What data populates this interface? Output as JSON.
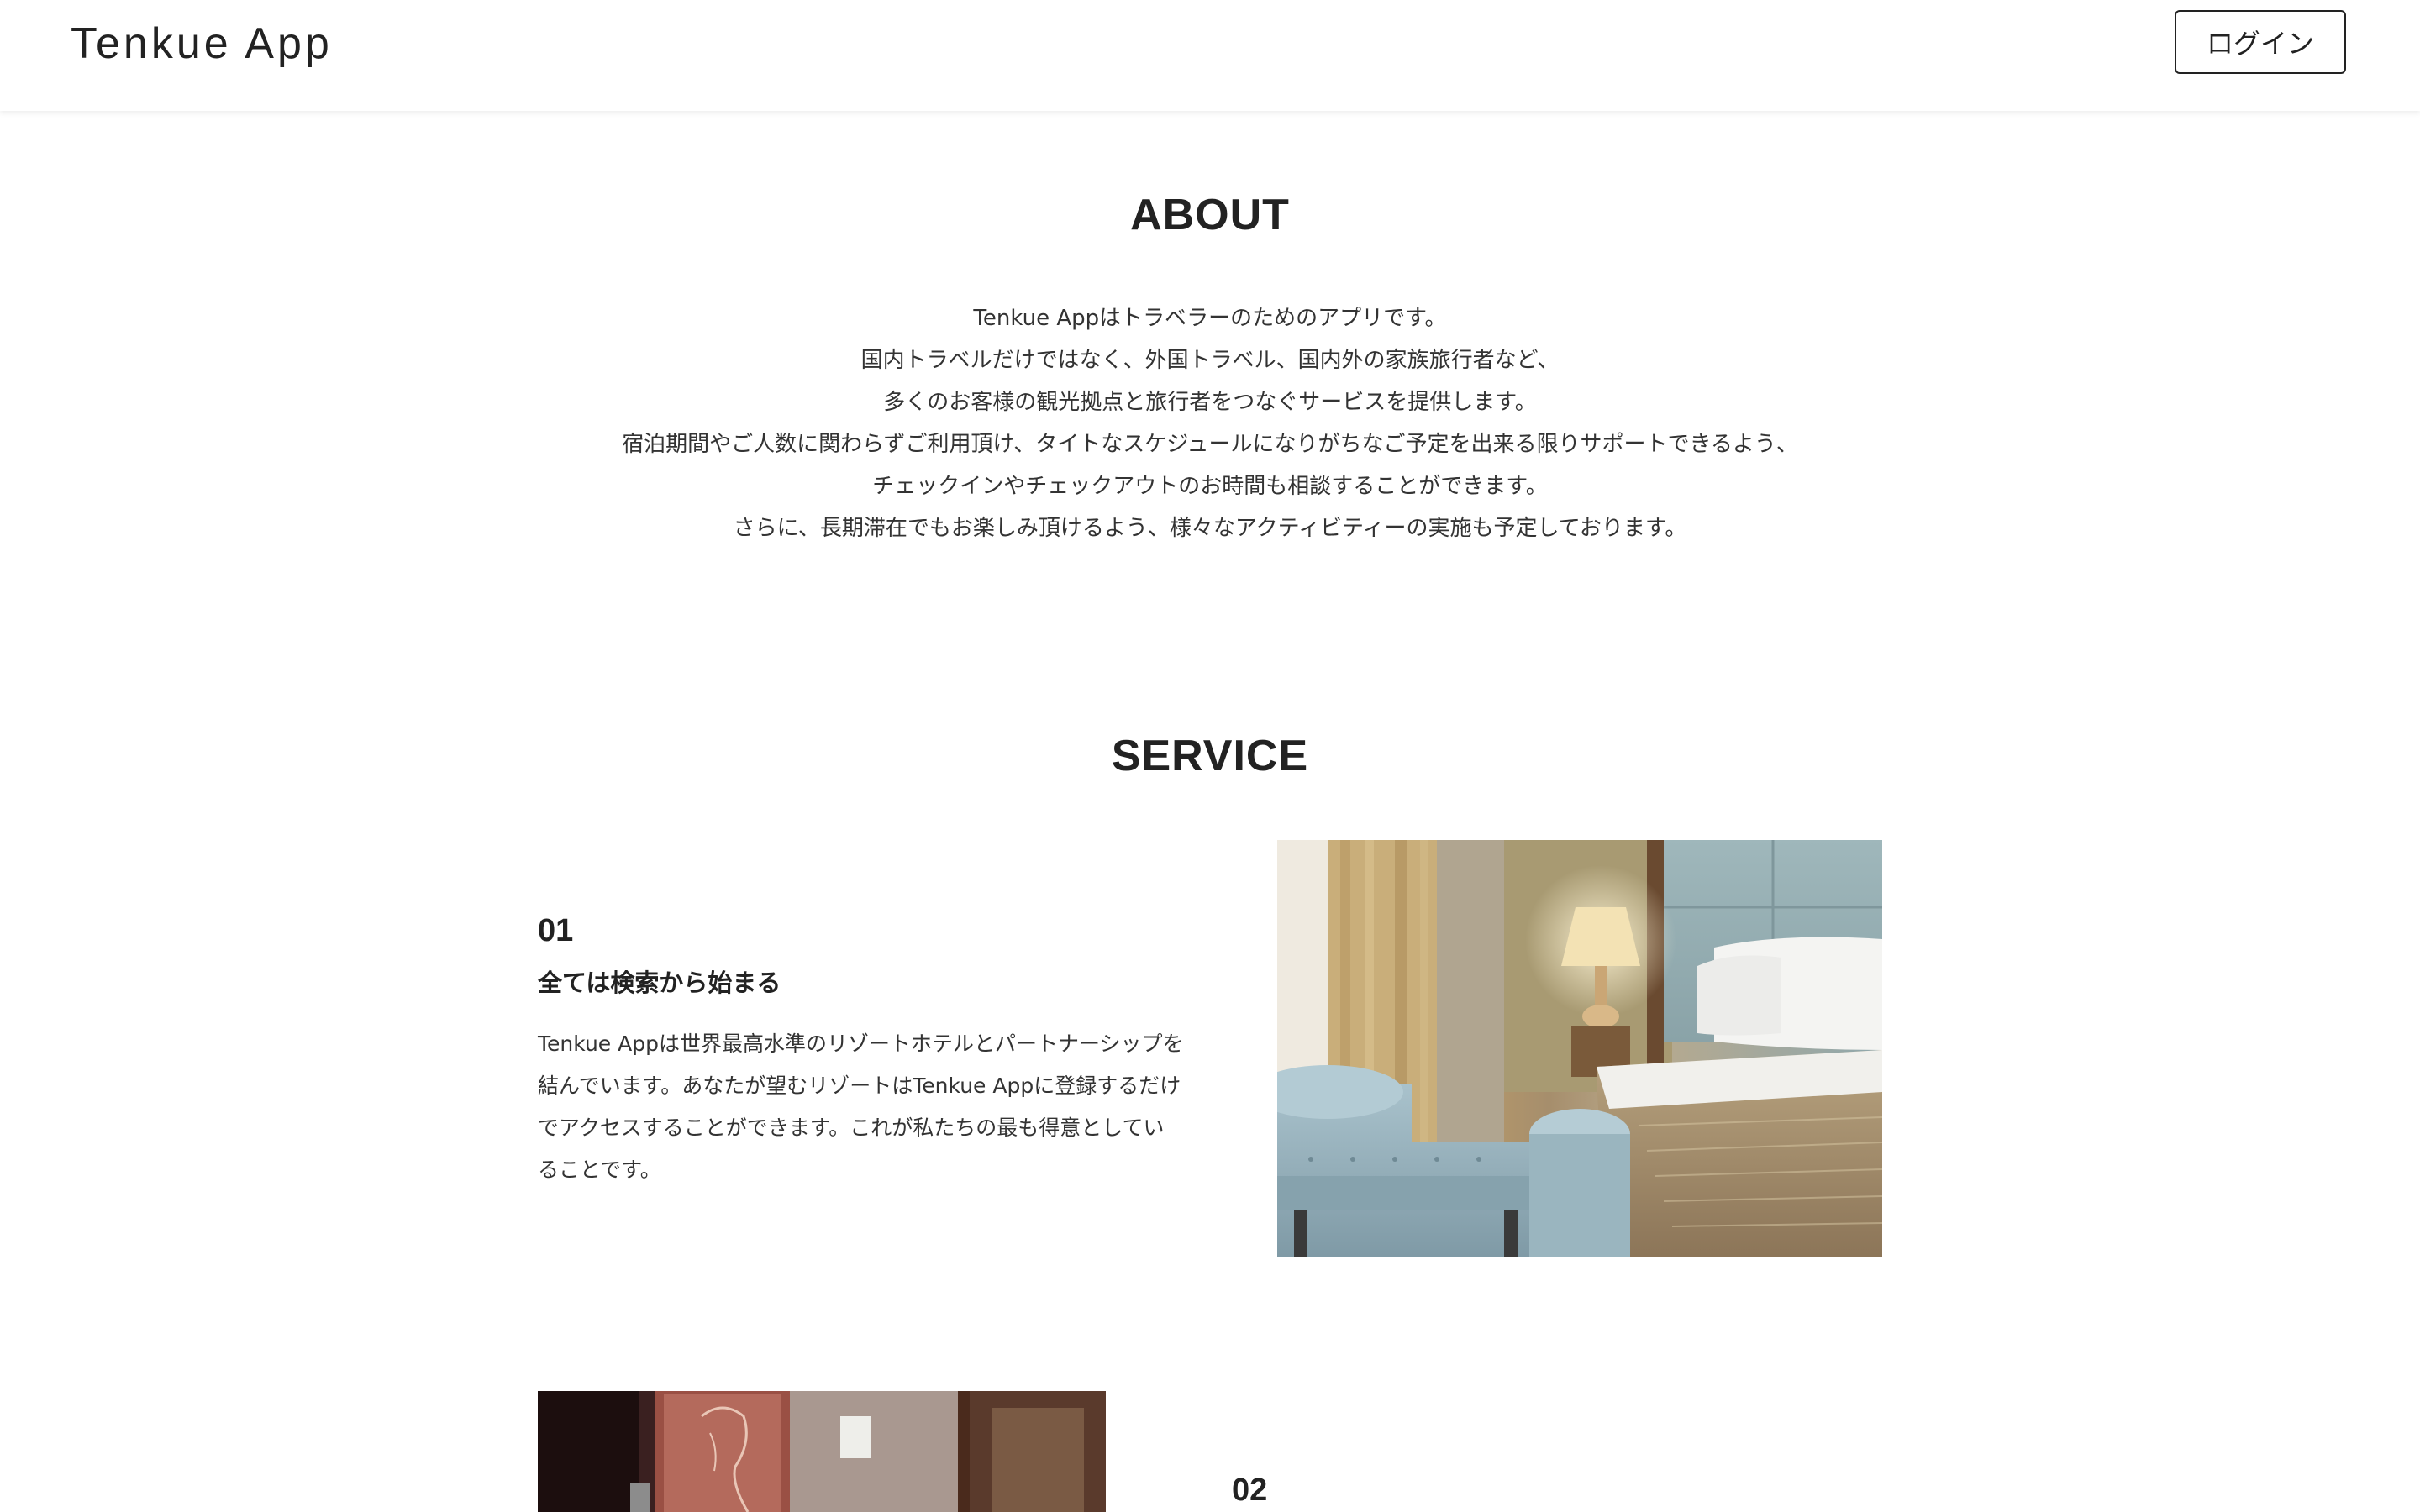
{
  "header": {
    "app_title": "Tenkue App",
    "login_label": "ログイン"
  },
  "about": {
    "title": "ABOUT",
    "lines": [
      "Tenkue Appはトラベラーのためのアプリです。",
      "国内トラベルだけではなく、外国トラベル、国内外の家族旅行者など、",
      "多くのお客様の観光拠点と旅行者をつなぐサービスを提供します。",
      "宿泊期間やご人数に関わらずご利用頂け、タイトなスケジュールになりがちなご予定を出来る限りサポートできるよう、",
      "チェックインやチェックアウトのお時間も相談することができます。",
      "さらに、長期滞在でもお楽しみ頂けるよう、様々なアクティビティーの実施も予定しております。"
    ]
  },
  "service": {
    "title": "SERVICE",
    "items": [
      {
        "number": "01",
        "title": "全ては検索から始まる",
        "description_lines": [
          "Tenkue Appは世界最高水準のリゾートホテルとパートナーシップを",
          "結んでいます。あなたが望むリゾートはTenkue Appに登録するだけ",
          "でアクセスすることができます。これが私たちの最も得意としてい",
          "ることです。"
        ]
      },
      {
        "number": "02"
      }
    ]
  },
  "colors": {
    "text": "#222222",
    "background": "#ffffff",
    "border": "#222222"
  }
}
